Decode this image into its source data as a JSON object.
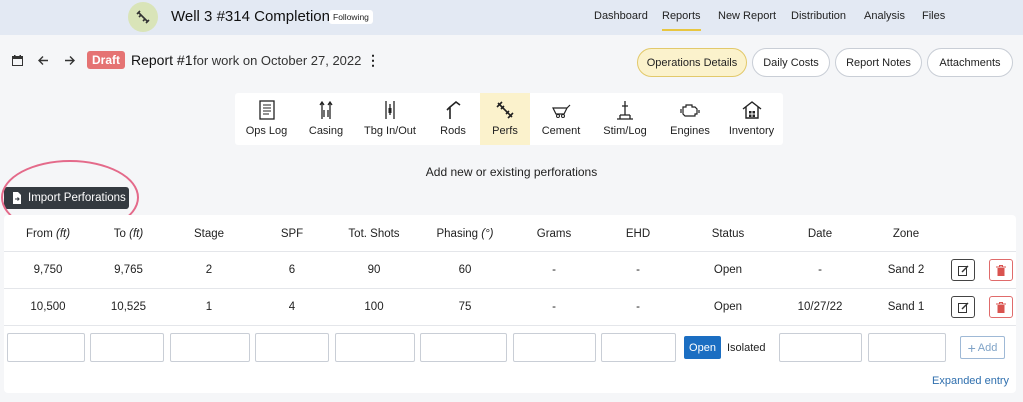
{
  "header": {
    "well_title": "Well 3 #314 Completion",
    "following": "Following",
    "nav": [
      "Dashboard",
      "Reports",
      "New Report",
      "Distribution",
      "Analysis",
      "Files"
    ],
    "active_nav": "Reports"
  },
  "report": {
    "status": "Draft",
    "title": "Report #1",
    "subtitle": "for work on October 27, 2022",
    "kebab": "⋮"
  },
  "tabs": [
    "Operations Details",
    "Daily Costs",
    "Report Notes",
    "Attachments"
  ],
  "active_tab": "Operations Details",
  "tools": [
    {
      "label": "Ops Log",
      "icon": "ops-log-icon"
    },
    {
      "label": "Casing",
      "icon": "casing-icon"
    },
    {
      "label": "Tbg In/Out",
      "icon": "tubing-icon"
    },
    {
      "label": "Rods",
      "icon": "rods-icon"
    },
    {
      "label": "Perfs",
      "icon": "perfs-icon"
    },
    {
      "label": "Cement",
      "icon": "cement-icon"
    },
    {
      "label": "Stim/Log",
      "icon": "stim-log-icon"
    },
    {
      "label": "Engines",
      "icon": "engines-icon"
    },
    {
      "label": "Inventory",
      "icon": "inventory-icon"
    }
  ],
  "active_tool": "Perfs",
  "section_title": "Add new or existing perforations",
  "import_button": "Import Perforations",
  "table": {
    "columns": [
      "From",
      "To",
      "Stage",
      "SPF",
      "Tot. Shots",
      "Phasing",
      "Grams",
      "EHD",
      "Status",
      "Date",
      "Zone"
    ],
    "units": {
      "from": "(ft)",
      "to": "(ft)",
      "phasing": "(°)"
    },
    "rows": [
      {
        "from": "9,750",
        "to": "9,765",
        "stage": "2",
        "spf": "6",
        "shots": "90",
        "phasing": "60",
        "grams": "-",
        "ehd": "-",
        "status": "Open",
        "date": "-",
        "zone": "Sand 2"
      },
      {
        "from": "10,500",
        "to": "10,525",
        "stage": "1",
        "spf": "4",
        "shots": "100",
        "phasing": "75",
        "grams": "-",
        "ehd": "-",
        "status": "Open",
        "date": "10/27/22",
        "zone": "Sand 1"
      }
    ]
  },
  "new_row": {
    "open_label": "Open",
    "isolated_label": "Isolated",
    "add_label": "Add"
  },
  "expanded_entry": "Expanded entry",
  "colors": {
    "accent": "#1b6ec2",
    "draft": "#e57373",
    "active_bg": "#fbf2cc",
    "highlight": "#e46a8a"
  }
}
